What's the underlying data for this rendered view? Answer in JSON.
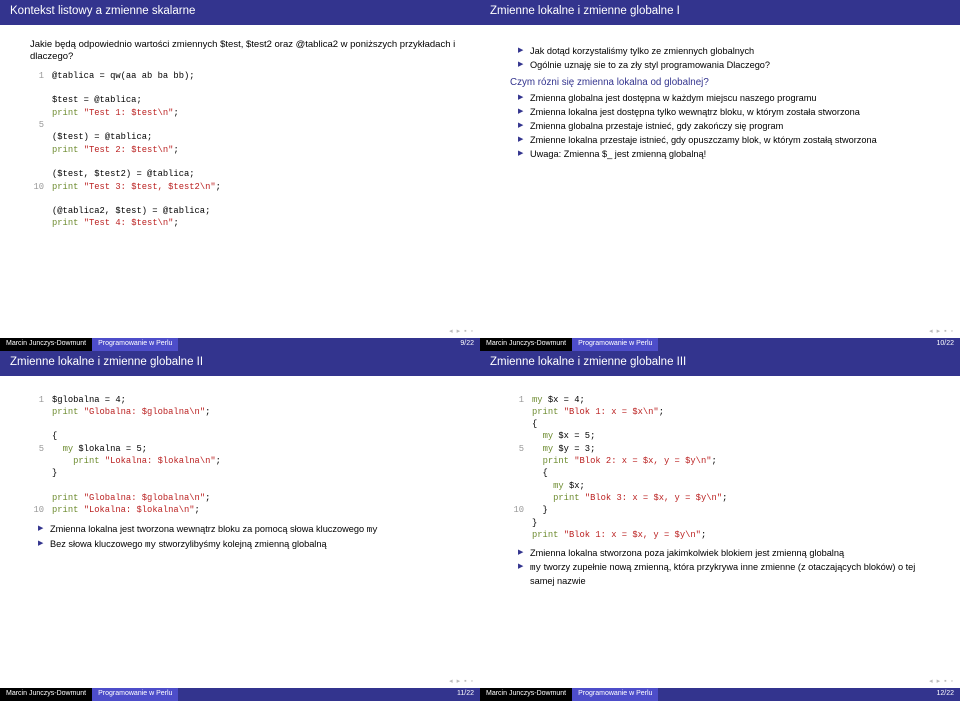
{
  "slides": {
    "s1": {
      "title": "Kontekst listowy a zmienne skalarne",
      "lead": "Jakie będą odpowiednio wartości zmiennych $test, $test2 oraz @tablica2 w poniższych przykładach i dlaczego?",
      "code_lines": {
        "l1": "@tablica = qw(aa ab ba bb);",
        "l3": "$test = @tablica;",
        "l4": "print \"Test 1: $test\\n\";",
        "l6": "($test) = @tablica;",
        "l7": "print \"Test 2: $test\\n\";",
        "l9": "($test, $test2) = @tablica;",
        "l10": "print \"Test 3: $test, $test2\\n\";",
        "l12": "(@tablica2, $test) = @tablica;",
        "l13": "print \"Test 4: $test\\n\";"
      },
      "page": "9/22"
    },
    "s2": {
      "title": "Zmienne lokalne i zmienne globalne I",
      "b1": "Jak dotąd korzystaliśmy tylko ze zmiennych globalnych",
      "b2": "Ogólnie uznaję sie to za zły styl programowania Dlaczego?",
      "sub": "Czym rózni się zmienna lokalna od globalnej?",
      "b3": "Zmienna globalna jest dostępna w każdym miejscu naszego programu",
      "b4": "Zmienna lokalna jest dostępna tylko wewnątrz bloku, w którym została stworzona",
      "b5": "Zmienna globalna przestaje istnieć, gdy zakończy się program",
      "b6": "Zmienne lokalna przestaje istnieć, gdy opuszczamy blok, w którym zostałą stworzona",
      "b7": "Uwaga: Zmienna $_ jest zmienną globalną!",
      "page": "10/22"
    },
    "s3": {
      "title": "Zmienne lokalne i zmienne globalne II",
      "code_lines": {
        "l1": "$globalna = 4;",
        "l2": "print \"Globalna: $globalna\\n\";",
        "l4": "{",
        "l5": "  my $lokalna = 5;",
        "l6": "    print \"Lokalna: $lokalna\\n\";",
        "l7": "}",
        "l9": "print \"Globalna: $globalna\\n\";",
        "l10": "print \"Lokalna: $lokalna\\n\";"
      },
      "b1_a": "Zmienna lokalna jest tworzona wewnątrz bloku za pomocą słowa kluczowego ",
      "b1_b": "my",
      "b2_a": "Bez słowa kluczowego ",
      "b2_b": "my",
      "b2_c": " stworzylibyśmy kolejną zmienną globalną",
      "page": "11/22"
    },
    "s4": {
      "title": "Zmienne lokalne i zmienne globalne III",
      "code_lines": {
        "l1": "my $x = 4;",
        "l2": "print \"Blok 1: x = $x\\n\";",
        "l3": "{",
        "l4": "  my $x = 5;",
        "l5": "  my $y = 3;",
        "l6": "  print \"Blok 2: x = $x, y = $y\\n\";",
        "l7": "  {",
        "l8": "    my $x;",
        "l9": "    print \"Blok 3: x = $x, y = $y\\n\";",
        "l10": "  }",
        "l11": "}",
        "l12": "print \"Blok 1: x = $x, y = $y\\n\";"
      },
      "b1": "Zmienna lokalna stworzona poza jakimkolwiek blokiem jest zmienną globalną",
      "b2_a": "my",
      "b2_b": " tworzy zupełnie nową zmienną, która przykrywa inne zmienne (z otaczających bloków) o tej samej nazwie",
      "page": "12/22"
    },
    "footer": {
      "author": "Marcin Junczys-Dowmunt",
      "course": "Programowanie w Perlu"
    }
  }
}
